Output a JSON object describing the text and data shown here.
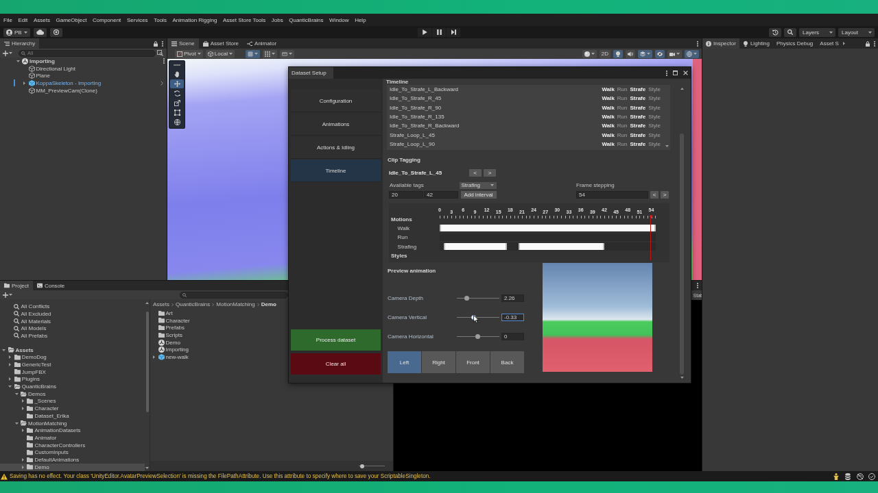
{
  "menu_bar": {
    "items": [
      "File",
      "Edit",
      "Assets",
      "GameObject",
      "Component",
      "Services",
      "Tools",
      "Animation Rigging",
      "Asset Store Tools",
      "Jobs",
      "QuanticBrains",
      "Window",
      "Help"
    ]
  },
  "toolbar": {
    "account": "PB",
    "layers": "Layers",
    "layout": "Layout"
  },
  "hierarchy": {
    "title": "Hierarchy",
    "search": {
      "placeholder": "All"
    },
    "tree": [
      {
        "label": "Importing",
        "kind": "scene",
        "expanded": true,
        "selected": false,
        "children": [
          {
            "label": "Directional Light",
            "kind": "object",
            "selected": false
          },
          {
            "label": "Plane",
            "kind": "object",
            "selected": false
          },
          {
            "label": "KoppaSkeleton - Importing",
            "kind": "prefab",
            "expanded": false,
            "selected": false
          },
          {
            "label": "MM_PreviewCam(Clone)",
            "kind": "object",
            "selected": false
          }
        ]
      }
    ]
  },
  "scene_view": {
    "tabs": [
      {
        "label": "Scene",
        "kind": "scene",
        "selected": true
      },
      {
        "label": "Asset Store",
        "kind": "store",
        "selected": false
      },
      {
        "label": "Animator",
        "kind": "animator",
        "selected": false
      }
    ],
    "handles": [
      {
        "kind": "pivot",
        "label": "Pivot"
      },
      {
        "kind": "space",
        "label": "Local"
      }
    ],
    "snapping": [
      {
        "kind": "grid",
        "on": true
      },
      {
        "kind": "snap",
        "on": false
      },
      {
        "kind": "increment",
        "on": false
      }
    ],
    "view_options": [
      {
        "kind": "shading",
        "on": false
      },
      {
        "kind": "mode_2d",
        "label": "2D",
        "on": false
      },
      {
        "kind": "lighting",
        "on": true
      },
      {
        "kind": "audio",
        "on": false
      },
      {
        "kind": "effects",
        "on": true
      },
      {
        "kind": "visibility",
        "on": true
      },
      {
        "kind": "camera",
        "on": false
      },
      {
        "kind": "gizmos",
        "on": true
      }
    ],
    "tools": [
      {
        "kind": "hand",
        "selected": false
      },
      {
        "kind": "move",
        "selected": true
      },
      {
        "kind": "rotate",
        "selected": false
      },
      {
        "kind": "scale",
        "selected": false
      },
      {
        "kind": "rect",
        "selected": false
      },
      {
        "kind": "transform",
        "selected": false
      }
    ]
  },
  "inspector": {
    "tabs": [
      {
        "label": "Inspector",
        "kind": "inspector",
        "selected": true
      },
      {
        "label": "Lighting",
        "kind": "lighting",
        "selected": false
      },
      {
        "label": "Physics Debug",
        "kind": "plain",
        "selected": false
      },
      {
        "label": "Asset S",
        "kind": "plain",
        "selected": false
      }
    ]
  },
  "game_view": {
    "stats": "Stat"
  },
  "project": {
    "tabs": [
      {
        "label": "Project",
        "kind": "project",
        "selected": true
      },
      {
        "label": "Console",
        "kind": "console",
        "selected": false
      }
    ],
    "favorites": [
      {
        "label": "All Conflicts",
        "selected": false
      },
      {
        "label": "All Excluded",
        "selected": false
      },
      {
        "label": "All Materials",
        "selected": false
      },
      {
        "label": "All Models",
        "selected": false
      },
      {
        "label": "All Prefabs",
        "selected": false
      }
    ],
    "tree": [
      {
        "label": "Assets",
        "expanded": true,
        "selected": false,
        "children": [
          {
            "label": "DemoDog",
            "expanded": false,
            "selected": false
          },
          {
            "label": "GenericTest",
            "expanded": false,
            "selected": false
          },
          {
            "label": "JumpFBX",
            "selected": false
          },
          {
            "label": "Plugins",
            "expanded": false,
            "selected": false
          },
          {
            "label": "QuanticBrains",
            "expanded": true,
            "selected": false,
            "children": [
              {
                "label": "Demos",
                "expanded": true,
                "selected": false,
                "children": [
                  {
                    "label": "_Scenes",
                    "expanded": false,
                    "selected": false
                  },
                  {
                    "label": "Character",
                    "expanded": false,
                    "selected": false
                  },
                  {
                    "label": "Dataset_Erika",
                    "selected": false
                  }
                ]
              },
              {
                "label": "MotionMatching",
                "expanded": true,
                "selected": false,
                "children": [
                  {
                    "label": "AnimationDatasets",
                    "expanded": false,
                    "selected": false
                  },
                  {
                    "label": "Animator",
                    "selected": false
                  },
                  {
                    "label": "CharacterControllers",
                    "selected": false
                  },
                  {
                    "label": "CustomInputs",
                    "selected": false
                  },
                  {
                    "label": "DefaultAnimations",
                    "expanded": false,
                    "selected": false
                  },
                  {
                    "label": "Demo",
                    "expanded": false,
                    "selected": true
                  }
                ]
              }
            ]
          }
        ]
      }
    ],
    "breadcrumb": [
      "Assets",
      "QuanticBrains",
      "MotionMatching",
      "Demo"
    ],
    "items": [
      {
        "label": "Art",
        "kind": "folder",
        "selected": false
      },
      {
        "label": "Character",
        "kind": "folder",
        "selected": false
      },
      {
        "label": "Prefabs",
        "kind": "folder",
        "selected": false
      },
      {
        "label": "Scripts",
        "kind": "folder",
        "selected": false
      },
      {
        "label": "Demo",
        "kind": "scene",
        "selected": false
      },
      {
        "label": "Importing",
        "kind": "scene",
        "selected": false
      },
      {
        "label": "new-walk",
        "kind": "model",
        "expanded": false,
        "selected": false
      }
    ],
    "icon_size": {
      "level": 0.12
    }
  },
  "dataset_setup": {
    "title": "Dataset Setup",
    "nav": [
      {
        "label": "Configuration",
        "selected": false
      },
      {
        "label": "Animations",
        "selected": false
      },
      {
        "label": "Actions & Idling",
        "selected": false
      },
      {
        "label": "Timeline",
        "selected": true
      }
    ],
    "actions": [
      {
        "label": "Process dataset",
        "kind": "process"
      },
      {
        "label": "Clear all",
        "kind": "clear"
      }
    ],
    "timeline": {
      "title": "Timeline",
      "clips": [
        {
          "name": "Idle_To_Strafe_L_Backward",
          "tags": [
            {
              "label": "Walk",
              "on": true
            },
            {
              "label": "Run",
              "on": false
            },
            {
              "label": "Strafe",
              "on": true
            },
            {
              "label": "Style",
              "on": false
            }
          ]
        },
        {
          "name": "Idle_To_Strafe_R_45",
          "tags": [
            {
              "label": "Walk",
              "on": true
            },
            {
              "label": "Run",
              "on": false
            },
            {
              "label": "Strafe",
              "on": true
            },
            {
              "label": "Style",
              "on": false
            }
          ]
        },
        {
          "name": "Idle_To_Strafe_R_90",
          "tags": [
            {
              "label": "Walk",
              "on": true
            },
            {
              "label": "Run",
              "on": false
            },
            {
              "label": "Strafe",
              "on": true
            },
            {
              "label": "Style",
              "on": false
            }
          ]
        },
        {
          "name": "Idle_To_Strafe_R_135",
          "tags": [
            {
              "label": "Walk",
              "on": true
            },
            {
              "label": "Run",
              "on": false
            },
            {
              "label": "Strafe",
              "on": true
            },
            {
              "label": "Style",
              "on": false
            }
          ]
        },
        {
          "name": "Idle_To_Strafe_R_Backward",
          "tags": [
            {
              "label": "Walk",
              "on": true
            },
            {
              "label": "Run",
              "on": false
            },
            {
              "label": "Strafe",
              "on": true
            },
            {
              "label": "Style",
              "on": false
            }
          ]
        },
        {
          "name": "Strafe_Loop_L_45",
          "tags": [
            {
              "label": "Walk",
              "on": true
            },
            {
              "label": "Run",
              "on": false
            },
            {
              "label": "Strafe",
              "on": true
            },
            {
              "label": "Style",
              "on": false
            }
          ]
        },
        {
          "name": "Strafe_Loop_L_90",
          "tags": [
            {
              "label": "Walk",
              "on": true
            },
            {
              "label": "Run",
              "on": false
            },
            {
              "label": "Strafe",
              "on": true
            },
            {
              "label": "Style",
              "on": false
            }
          ]
        }
      ]
    },
    "clip_tagging": {
      "title": "Clip Tagging",
      "clip": "Idle_To_Strafe_L_45",
      "prev": "<",
      "next": ">",
      "tags_label": "Available tags",
      "tag": "Strafing",
      "interval_start": "20",
      "interval_end": "42",
      "add_button": "Add interval",
      "frame_label": "Frame stepping",
      "frame": "54",
      "frame_prev": "<",
      "frame_next": ">"
    },
    "motions": {
      "title": "Motions",
      "styles_title": "Styles",
      "ticks": [
        "0",
        "3",
        "6",
        "9",
        "12",
        "15",
        "18",
        "21",
        "24",
        "27",
        "30",
        "33",
        "36",
        "39",
        "42",
        "45",
        "48",
        "51",
        "54"
      ],
      "playhead": {
        "level": 0.979
      },
      "tracks": [
        {
          "label": "Walk",
          "intervals": [
            {
              "from": {
                "level": 0
              },
              "to": {
                "level": 1
              }
            }
          ]
        },
        {
          "label": "Run"
        },
        {
          "label": "Strafing",
          "intervals": [
            {
              "from": {
                "level": 0.02
              },
              "to": {
                "level": 0.311
              }
            },
            {
              "from": {
                "level": 0.365
              },
              "to": {
                "level": 0.763
              }
            }
          ]
        }
      ]
    },
    "preview": {
      "title": "Preview animation",
      "sliders": [
        {
          "label": "Camera Depth",
          "level": 0.24,
          "value": "2.26",
          "focused": false
        },
        {
          "label": "Camera Vertical",
          "level": 0.39,
          "value": "-0.33",
          "focused": true
        },
        {
          "label": "Camera Horizontal",
          "level": 0.49,
          "value": "0",
          "focused": false
        }
      ],
      "views": [
        {
          "label": "Left",
          "selected": true
        },
        {
          "label": "Right",
          "selected": false
        },
        {
          "label": "Front",
          "selected": false
        },
        {
          "label": "Back",
          "selected": false
        }
      ]
    }
  },
  "status_bar": {
    "kind": "warning",
    "message": "Saving has no effect. Your class 'UnityEditor.AvatarPreviewSelection' is missing the FilePathAttribute. Use this attribute to specify where to save your ScriptableSingleton."
  }
}
